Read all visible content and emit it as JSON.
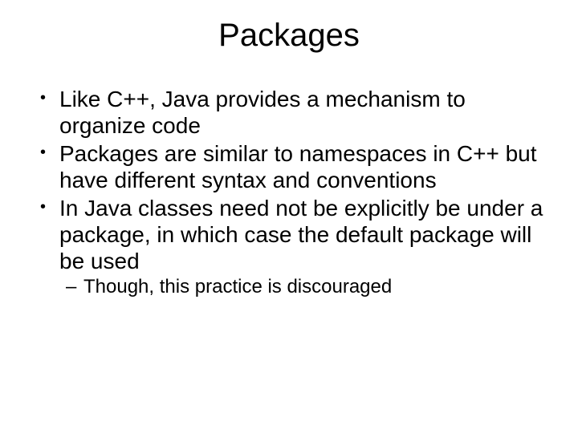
{
  "title": "Packages",
  "bullets": [
    {
      "text": "Like C++, Java provides a mechanism to organize code"
    },
    {
      "text": "Packages are similar to namespaces in C++ but have different syntax and conventions"
    },
    {
      "text": "In Java classes need not be explicitly be under a package, in which case the default package will be used",
      "sub": [
        {
          "text": "Though, this practice is discouraged"
        }
      ]
    }
  ]
}
